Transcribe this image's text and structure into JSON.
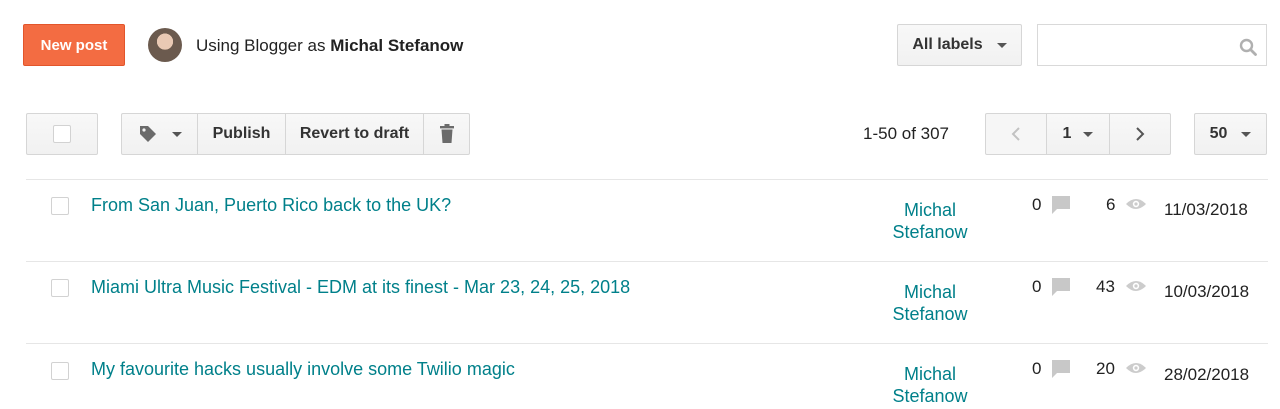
{
  "header": {
    "new_post_label": "New post",
    "using_prefix": "Using Blogger as",
    "user_name": "Michal Stefanow",
    "labels_dropdown": "All labels",
    "search_placeholder": ""
  },
  "toolbar": {
    "publish_label": "Publish",
    "revert_label": "Revert to draft",
    "range_text": "1-50 of 307",
    "page_number": "1",
    "page_size": "50"
  },
  "posts": [
    {
      "title": "From San Juan, Puerto Rico back to the UK?",
      "author_first": "Michal",
      "author_last": "Stefanow",
      "comments": "0",
      "views": "6",
      "date": "11/03/2018"
    },
    {
      "title": "Miami Ultra Music Festival - EDM at its finest - Mar 23, 24, 25, 2018",
      "author_first": "Michal",
      "author_last": "Stefanow",
      "comments": "0",
      "views": "43",
      "date": "10/03/2018"
    },
    {
      "title": "My favourite hacks usually involve some Twilio magic",
      "author_first": "Michal",
      "author_last": "Stefanow",
      "comments": "0",
      "views": "20",
      "date": "28/02/2018"
    }
  ],
  "colors": {
    "accent": "#f36c42",
    "link": "#00808a"
  }
}
